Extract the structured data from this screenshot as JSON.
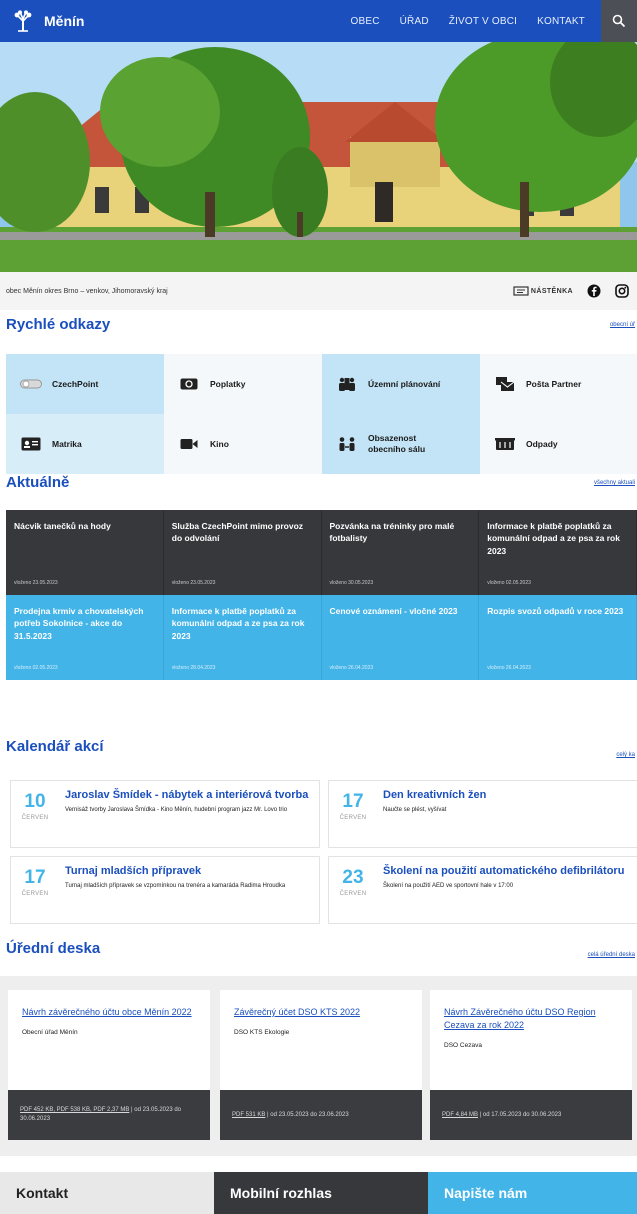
{
  "header": {
    "site_name": "Měnín",
    "nav": [
      "OBEC",
      "ÚŘAD",
      "ŽIVOT V OBCI",
      "KONTAKT"
    ]
  },
  "hero": {
    "caption": "obec Měnín okres Brno – venkov, Jihomoravský kraj",
    "nastenka": "NÁSTĚNKA"
  },
  "quick_links": {
    "title": "Rychlé odkazy",
    "all_link": "obecní úř",
    "items": [
      {
        "label": "CzechPoint",
        "icon": "toggle-icon"
      },
      {
        "label": "Poplatky",
        "icon": "money-icon"
      },
      {
        "label": "Územní plánování",
        "icon": "map-people-icon"
      },
      {
        "label": "Pošta Partner",
        "icon": "mail-icon"
      },
      {
        "label": "Matrika",
        "icon": "id-card-icon"
      },
      {
        "label": "Kino",
        "icon": "video-icon"
      },
      {
        "label": "Obsazenost obecního sálu",
        "icon": "people-icon"
      },
      {
        "label": "Odpady",
        "icon": "trash-icon"
      }
    ]
  },
  "news": {
    "title": "Aktuálně",
    "all_link": "všechny aktuali",
    "items": [
      {
        "title": "Nácvik tanečků na hody",
        "meta": "vloženo 23.05.2023"
      },
      {
        "title": "Služba CzechPoint mimo provoz do odvolání",
        "meta": "vloženo 23.05.2023"
      },
      {
        "title": "Pozvánka na tréninky pro malé fotbalisty",
        "meta": "vloženo 30.05.2023"
      },
      {
        "title": "Informace k platbě poplatků za komunální odpad a ze psa za rok 2023",
        "meta": "vloženo 02.05.2023"
      },
      {
        "title": "Prodejna krmiv a chovatelských potřeb Sokolnice - akce do 31.5.2023",
        "meta": "vloženo 02.05.2023"
      },
      {
        "title": "Informace k platbě poplatků za komunální odpad a ze psa za rok 2023",
        "meta": "vloženo 28.04.2023"
      },
      {
        "title": "Cenové oznámení - vločné 2023",
        "meta": "vloženo 26.04.2023"
      },
      {
        "title": "Rozpis svozů odpadů v roce 2023",
        "meta": "vloženo 26.04.2023"
      }
    ]
  },
  "calendar": {
    "title": "Kalendář akcí",
    "all_link": "celý ka",
    "events": [
      {
        "day": "10",
        "month": "ČERVEN",
        "title": "Jaroslav Šmídek - nábytek a interiérová tvorba",
        "desc": "Vernisáž tvorby Jaroslava Šmídka - Kino Měnín, hudební program jazz Mr. Lovo trio"
      },
      {
        "day": "17",
        "month": "ČERVEN",
        "title": "Den kreativních žen",
        "desc": "Naučte se plést, vyšívat"
      },
      {
        "day": "17",
        "month": "ČERVEN",
        "title": "Turnaj mladších přípravek",
        "desc": "Turnaj mladších přípravek se vzpomínkou na trenéra a kamaráda Radima Hroudka"
      },
      {
        "day": "23",
        "month": "ČERVEN",
        "title": "Školení na použití automatického defibrilátoru",
        "desc": "Školení na použití AED ve sportovní hale v 17:00"
      }
    ]
  },
  "board": {
    "title": "Úřední deska",
    "all_link": "celá úřední deska",
    "docs": [
      {
        "title": "Návrh závěrečného účtu obce Měnín 2022",
        "org": "Obecní úřad Měnín",
        "files": "PDF 452 KB, PDF 538 KB, PDF 2,37 MB",
        "dates": "od 23.05.2023 do 30.06.2023"
      },
      {
        "title": "Závěrečný účet DSO KTS 2022",
        "org": "DSO KTS Ekologie",
        "files": "PDF 531 KB",
        "dates": "od 23.05.2023 do 23.06.2023"
      },
      {
        "title": "Návrh Závěrečného účtu DSO Region Cezava za rok 2022",
        "org": "DSO Cezava",
        "files": "PDF 4,84 MB",
        "dates": "od 17.05.2023 do 30.06.2023"
      }
    ]
  },
  "footer": {
    "contact": "Kontakt",
    "radio": "Mobilní rozhlas",
    "write": "Napište nám"
  }
}
